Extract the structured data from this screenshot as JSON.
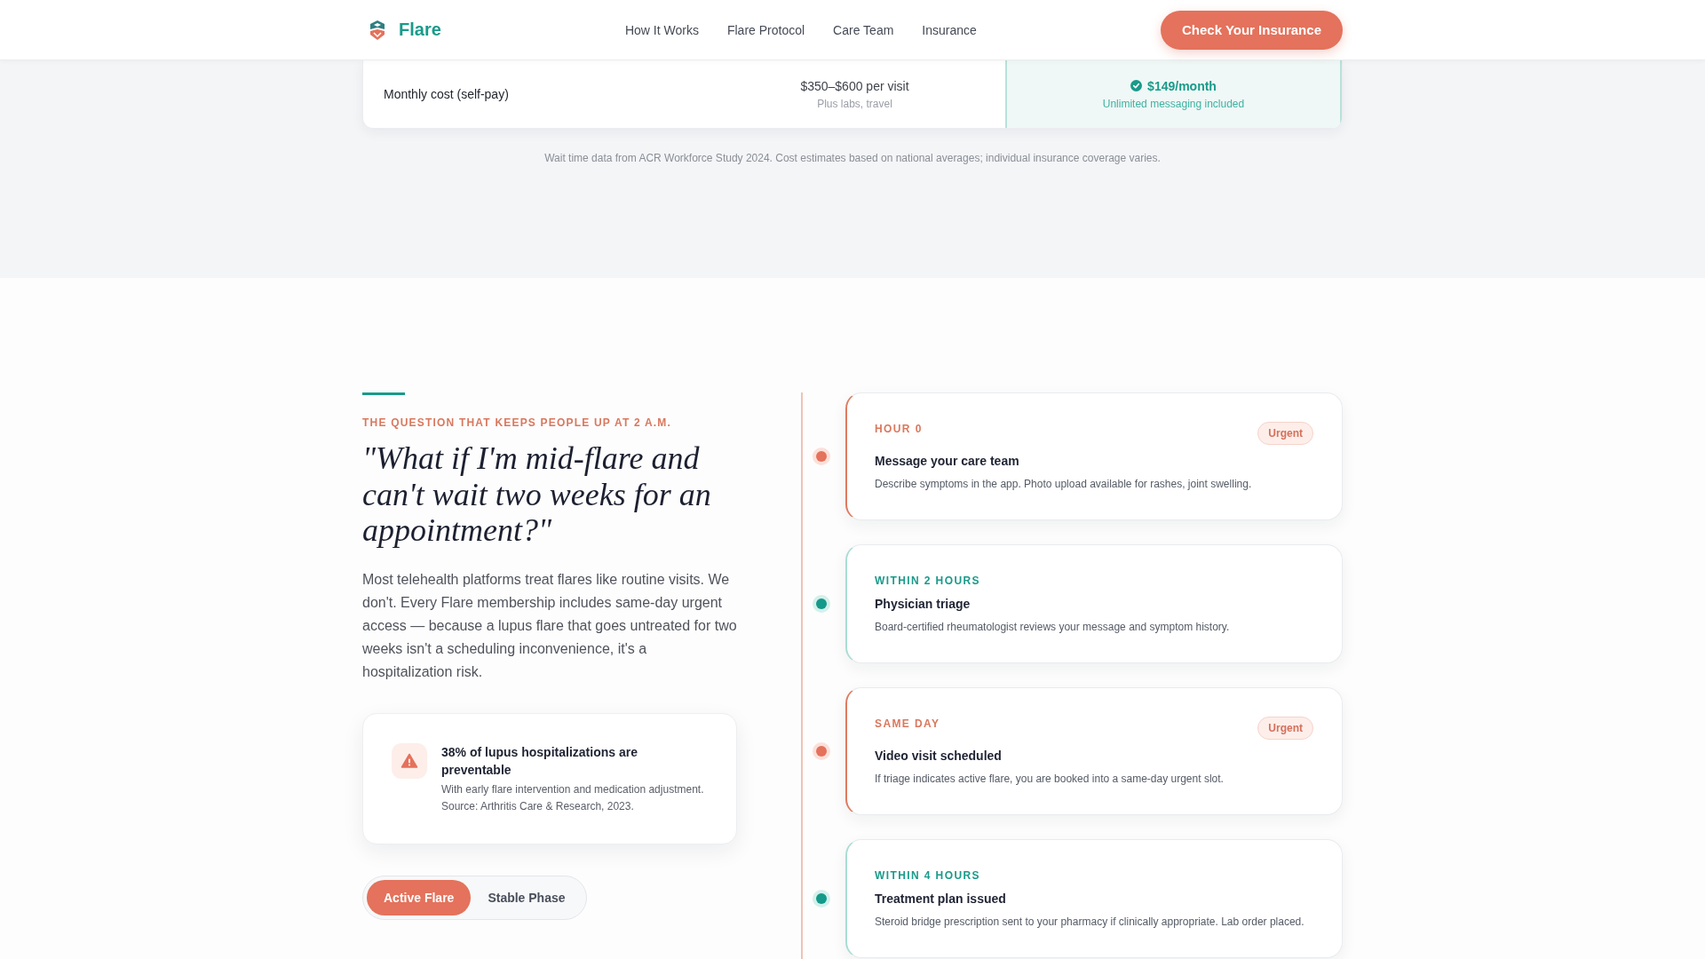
{
  "header": {
    "logo": "Flare",
    "nav": [
      "How It Works",
      "Flare Protocol",
      "Care Team",
      "Insurance"
    ],
    "cta": "Check Your Insurance"
  },
  "comparison": {
    "rows": [
      {
        "label": "Monthly cost (self-pay)",
        "cells": [
          {
            "value": "$350–$600 per visit",
            "note": "Plus labs, travel",
            "highlighted": false
          },
          {
            "value": "$149/month",
            "note": "Unlimited messaging included",
            "highlighted": true
          }
        ]
      }
    ],
    "footnote": "Wait time data from ACR Workforce Study 2024. Cost estimates based on national averages; individual insurance coverage varies."
  },
  "urgent_access": {
    "eyebrow": "THE QUESTION THAT KEEPS PEOPLE UP AT 2 A.M.",
    "heading": "\"What if I'm mid-flare and can't wait two weeks for an appointment?\"",
    "body": "Most telehealth platforms treat flares like routine visits. We don't. Every Flare membership includes same-day urgent access — because a lupus flare that goes untreated for two weeks isn't a scheduling inconvenience, it's a hospitalization risk.",
    "stat": {
      "title": "38% of lupus hospitalizations are preventable",
      "detail": "With early flare intervention and medication adjustment. Source: Arthritis Care & Research, 2023."
    },
    "phase_toggle": [
      {
        "label": "Active Flare",
        "selected": true
      },
      {
        "label": "Stable Phase",
        "selected": false
      }
    ],
    "timeline": [
      {
        "time": "HOUR 0",
        "urgent": true,
        "badge": "Urgent",
        "title": "Message your care team",
        "description": "Describe symptoms in the app. Photo upload available for rashes, joint swelling."
      },
      {
        "time": "WITHIN 2 HOURS",
        "urgent": false,
        "title": "Physician triage",
        "description": "Board-certified rheumatologist reviews your message and symptom history."
      },
      {
        "time": "SAME DAY",
        "urgent": true,
        "badge": "Urgent",
        "title": "Video visit scheduled",
        "description": "If triage indicates active flare, you are booked into a same-day urgent slot."
      },
      {
        "time": "WITHIN 4 HOURS",
        "urgent": false,
        "title": "Treatment plan issued",
        "description": "Steroid bridge prescription sent to your pharmacy if clinically appropriate. Lab order placed."
      }
    ]
  }
}
